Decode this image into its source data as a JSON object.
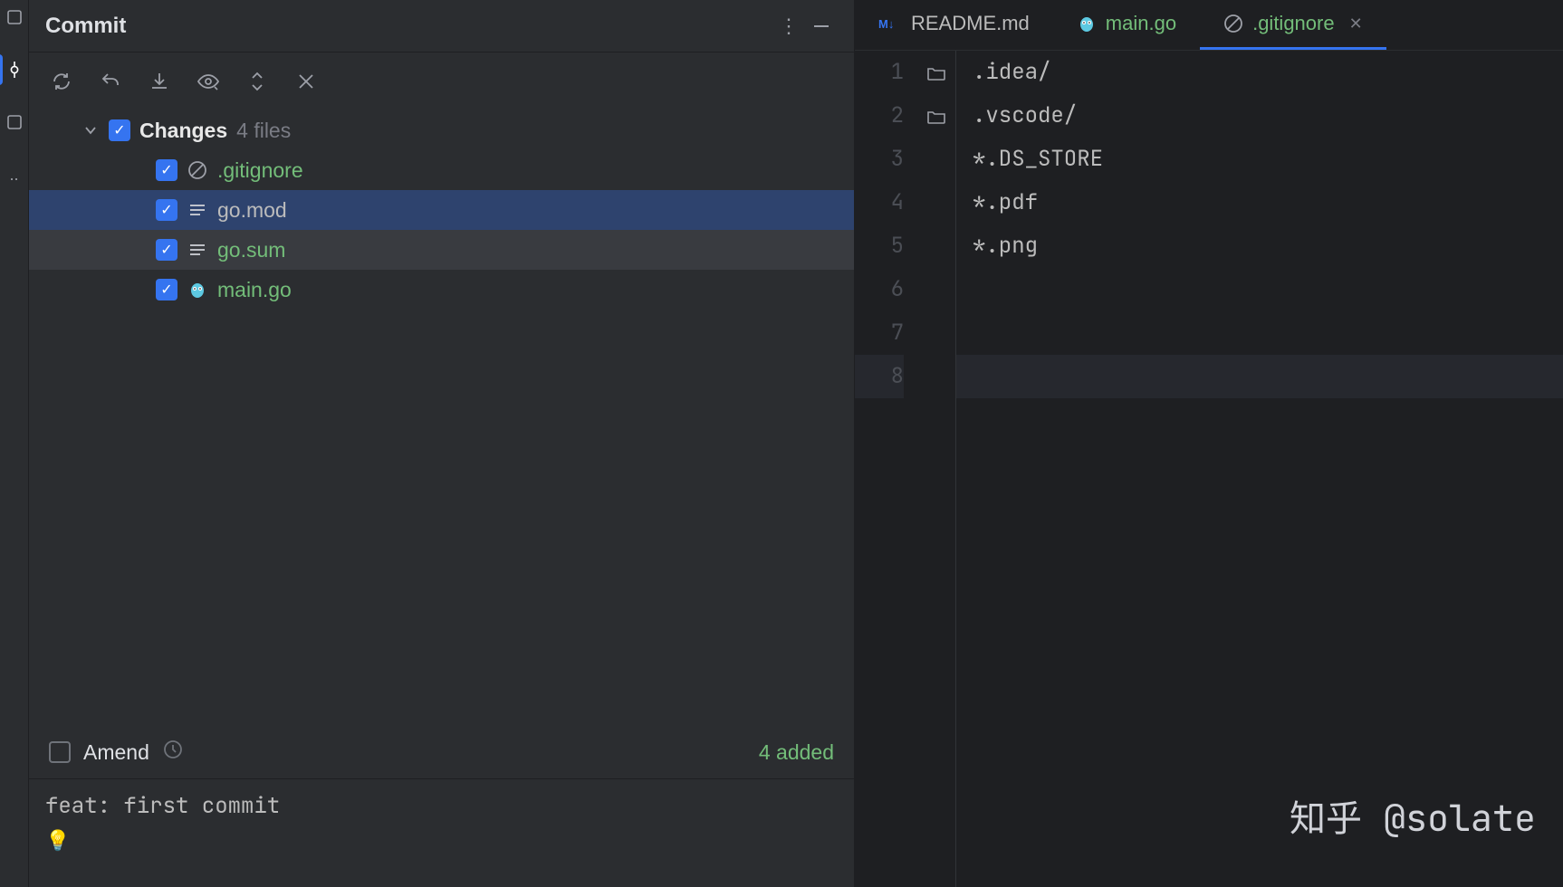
{
  "iconStrip": {
    "items": [
      "box-outline",
      "commit-active",
      "box-outline-2",
      "dots"
    ]
  },
  "commit": {
    "title": "Commit",
    "changesLabel": "Changes",
    "fileCount": "4 files",
    "files": [
      {
        "name": ".gitignore",
        "icon": "ignore-icon",
        "color": "green",
        "selected": false,
        "hover": false
      },
      {
        "name": "go.mod",
        "icon": "lines-icon",
        "color": "default",
        "selected": true,
        "hover": false
      },
      {
        "name": "go.sum",
        "icon": "lines-icon",
        "color": "green",
        "selected": false,
        "hover": true
      },
      {
        "name": "main.go",
        "icon": "gopher-icon",
        "color": "green",
        "selected": false,
        "hover": false
      }
    ],
    "amendLabel": "Amend",
    "addedInfo": "4 added",
    "message": "feat: first commit"
  },
  "editor": {
    "tabs": [
      {
        "name": "README.md",
        "icon": "markdown-icon",
        "active": false,
        "color": "default",
        "closable": false
      },
      {
        "name": "main.go",
        "icon": "gopher-icon",
        "active": false,
        "color": "green",
        "closable": false
      },
      {
        "name": ".gitignore",
        "icon": "ignore-icon",
        "active": true,
        "color": "green",
        "closable": true
      }
    ],
    "lines": [
      {
        "num": "1",
        "text": ".idea/",
        "fold": true
      },
      {
        "num": "2",
        "text": ".vscode/",
        "fold": true
      },
      {
        "num": "3",
        "text": "*.DS_STORE",
        "fold": false
      },
      {
        "num": "4",
        "text": "*.pdf",
        "fold": false
      },
      {
        "num": "5",
        "text": "*.png",
        "fold": false
      },
      {
        "num": "6",
        "text": "",
        "fold": false
      },
      {
        "num": "7",
        "text": "",
        "fold": false
      },
      {
        "num": "8",
        "text": "",
        "fold": false,
        "current": true
      }
    ]
  },
  "watermark": "知乎 @solate"
}
